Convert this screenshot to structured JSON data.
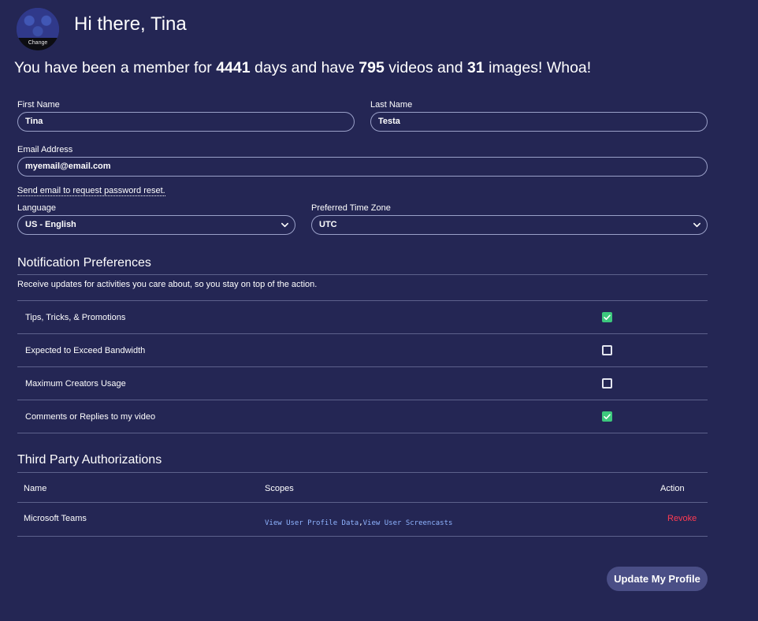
{
  "header": {
    "avatar_change_label": "Change",
    "greeting": "Hi there, Tina"
  },
  "membership": {
    "prefix": "You have been a member for",
    "days": "4441",
    "mid1": "days and have",
    "videos": "795",
    "mid2": "videos and",
    "images": "31",
    "suffix": "images! Whoa!"
  },
  "form": {
    "first_name_label": "First Name",
    "first_name_value": "Tina",
    "last_name_label": "Last Name",
    "last_name_value": "Testa",
    "email_label": "Email Address",
    "email_value": "myemail@email.com",
    "reset_link": "Send email to request password reset.",
    "language_label": "Language",
    "language_value": "US - English",
    "timezone_label": "Preferred Time Zone",
    "timezone_value": "UTC"
  },
  "notifications": {
    "title": "Notification Preferences",
    "description": "Receive updates for activities you care about, so you stay on top of the action.",
    "items": [
      {
        "label": "Tips, Tricks, & Promotions",
        "checked": true
      },
      {
        "label": "Expected to Exceed Bandwidth",
        "checked": false
      },
      {
        "label": "Maximum Creators Usage",
        "checked": false
      },
      {
        "label": "Comments or Replies to my video",
        "checked": true
      }
    ]
  },
  "third_party": {
    "title": "Third Party Authorizations",
    "columns": [
      "Name",
      "Scopes",
      "Action"
    ],
    "rows": [
      {
        "name": "Microsoft Teams",
        "scopes": [
          "View User Profile Data",
          "View User Screencasts"
        ],
        "action": "Revoke"
      }
    ]
  },
  "footer": {
    "update_button": "Update My Profile"
  },
  "colors": {
    "background": "#242654",
    "checkbox_checked": "#3dc87d",
    "revoke": "#ff3b52",
    "scope_link": "#8fb4ff",
    "button": "#4a4e86"
  }
}
